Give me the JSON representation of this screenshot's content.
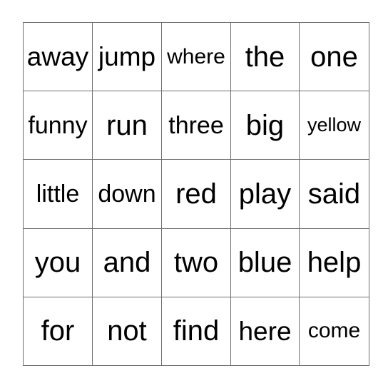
{
  "card": {
    "type": "bingo-card",
    "rows": 5,
    "columns": 5,
    "grid_line_color": "#6e6e6e",
    "outer_border_color": "#5f5f5f",
    "background_color": "#ffffff",
    "text_color": "#000000",
    "cells": [
      [
        {
          "word": "away",
          "size": "l"
        },
        {
          "word": "jump",
          "size": "l"
        },
        {
          "word": "where",
          "size": "s"
        },
        {
          "word": "the",
          "size": "xl"
        },
        {
          "word": "one",
          "size": "xl"
        }
      ],
      [
        {
          "word": "funny",
          "size": "m"
        },
        {
          "word": "run",
          "size": "xl"
        },
        {
          "word": "three",
          "size": "m"
        },
        {
          "word": "big",
          "size": "xl"
        },
        {
          "word": "yellow",
          "size": "xs"
        }
      ],
      [
        {
          "word": "little",
          "size": "m"
        },
        {
          "word": "down",
          "size": "m"
        },
        {
          "word": "red",
          "size": "xl"
        },
        {
          "word": "play",
          "size": "xl"
        },
        {
          "word": "said",
          "size": "xl"
        }
      ],
      [
        {
          "word": "you",
          "size": "xl"
        },
        {
          "word": "and",
          "size": "xl"
        },
        {
          "word": "two",
          "size": "xl"
        },
        {
          "word": "blue",
          "size": "xl"
        },
        {
          "word": "help",
          "size": "xl"
        }
      ],
      [
        {
          "word": "for",
          "size": "xl"
        },
        {
          "word": "not",
          "size": "xl"
        },
        {
          "word": "find",
          "size": "xl"
        },
        {
          "word": "here",
          "size": "l"
        },
        {
          "word": "come",
          "size": "s"
        }
      ]
    ]
  }
}
